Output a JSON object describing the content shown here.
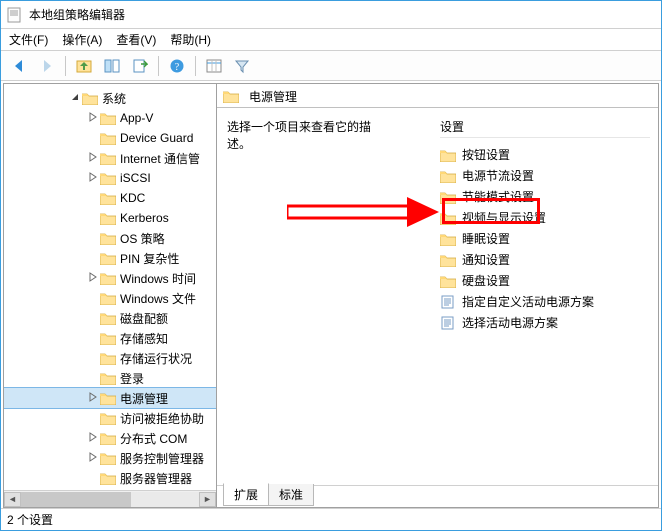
{
  "titlebar": {
    "title": "本地组策略编辑器"
  },
  "menubar": {
    "file": "文件(F)",
    "action": "操作(A)",
    "view": "查看(V)",
    "help": "帮助(H)"
  },
  "toolbar_icons": {
    "back": "back-icon",
    "forward": "forward-icon",
    "up": "up-icon",
    "show": "show-icon",
    "props": "properties-icon",
    "export": "export-icon",
    "help": "help-icon",
    "cols": "columns-icon",
    "filter": "filter-icon"
  },
  "tree": {
    "top_label": "系统",
    "items": [
      {
        "label": "App-V",
        "caret": "closed"
      },
      {
        "label": "Device Guard",
        "caret": "none"
      },
      {
        "label": "Internet 通信管",
        "caret": "closed"
      },
      {
        "label": "iSCSI",
        "caret": "closed"
      },
      {
        "label": "KDC",
        "caret": "none"
      },
      {
        "label": "Kerberos",
        "caret": "none"
      },
      {
        "label": "OS 策略",
        "caret": "none"
      },
      {
        "label": "PIN 复杂性",
        "caret": "none"
      },
      {
        "label": "Windows 时间",
        "caret": "closed"
      },
      {
        "label": "Windows 文件",
        "caret": "none"
      },
      {
        "label": "磁盘配额",
        "caret": "none"
      },
      {
        "label": "存储感知",
        "caret": "none"
      },
      {
        "label": "存储运行状况",
        "caret": "none"
      },
      {
        "label": "登录",
        "caret": "none"
      },
      {
        "label": "电源管理",
        "caret": "closed",
        "selected": true
      },
      {
        "label": "访问被拒绝协助",
        "caret": "none"
      },
      {
        "label": "分布式 COM",
        "caret": "closed"
      },
      {
        "label": "服务控制管理器",
        "caret": "closed"
      },
      {
        "label": "服务器管理器",
        "caret": "none"
      }
    ]
  },
  "content": {
    "header": "电源管理",
    "description": "选择一个项目来查看它的描述。",
    "column_header": "设置",
    "items": [
      {
        "type": "folder",
        "label": "按钮设置"
      },
      {
        "type": "folder",
        "label": "电源节流设置"
      },
      {
        "type": "folder",
        "label": "节能模式设置"
      },
      {
        "type": "folder",
        "label": "视频与显示设置"
      },
      {
        "type": "folder",
        "label": "睡眠设置",
        "highlight": true
      },
      {
        "type": "folder",
        "label": "通知设置"
      },
      {
        "type": "folder",
        "label": "硬盘设置"
      },
      {
        "type": "policy",
        "label": "指定自定义活动电源方案"
      },
      {
        "type": "policy",
        "label": "选择活动电源方案"
      }
    ]
  },
  "tabs": {
    "extended": "扩展",
    "standard": "标准"
  },
  "statusbar": {
    "text": "2 个设置"
  }
}
